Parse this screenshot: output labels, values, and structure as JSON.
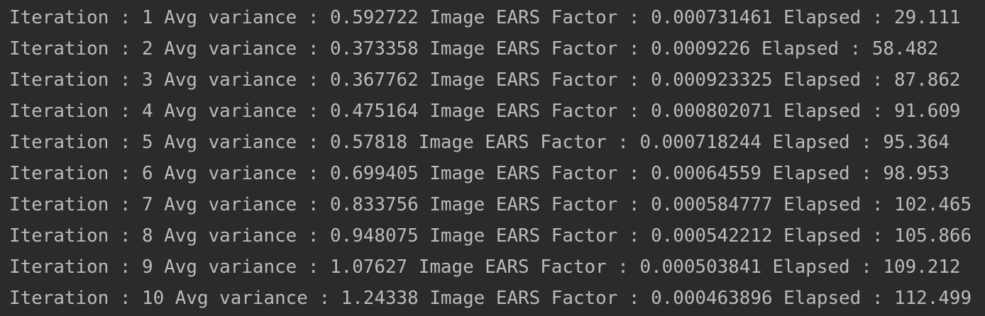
{
  "console": {
    "lines": [
      {
        "text": "Iteration : 1 Avg variance : 0.592722 Image EARS Factor : 0.000731461 Elapsed : 29.111"
      },
      {
        "text": "Iteration : 2 Avg variance : 0.373358 Image EARS Factor : 0.0009226 Elapsed : 58.482"
      },
      {
        "text": "Iteration : 3 Avg variance : 0.367762 Image EARS Factor : 0.000923325 Elapsed : 87.862"
      },
      {
        "text": "Iteration : 4 Avg variance : 0.475164 Image EARS Factor : 0.000802071 Elapsed : 91.609"
      },
      {
        "text": "Iteration : 5 Avg variance : 0.57818 Image EARS Factor : 0.000718244 Elapsed : 95.364"
      },
      {
        "text": "Iteration : 6 Avg variance : 0.699405 Image EARS Factor : 0.00064559 Elapsed : 98.953"
      },
      {
        "text": "Iteration : 7 Avg variance : 0.833756 Image EARS Factor : 0.000584777 Elapsed : 102.465"
      },
      {
        "text": "Iteration : 8 Avg variance : 0.948075 Image EARS Factor : 0.000542212 Elapsed : 105.866"
      },
      {
        "text": "Iteration : 9 Avg variance : 1.07627 Image EARS Factor : 0.000503841 Elapsed : 109.212"
      },
      {
        "text": "Iteration : 10 Avg variance : 1.24338 Image EARS Factor : 0.000463896 Elapsed : 112.499"
      }
    ]
  },
  "colors": {
    "background": "#2b2b2b",
    "text": "#bbbbbb"
  }
}
